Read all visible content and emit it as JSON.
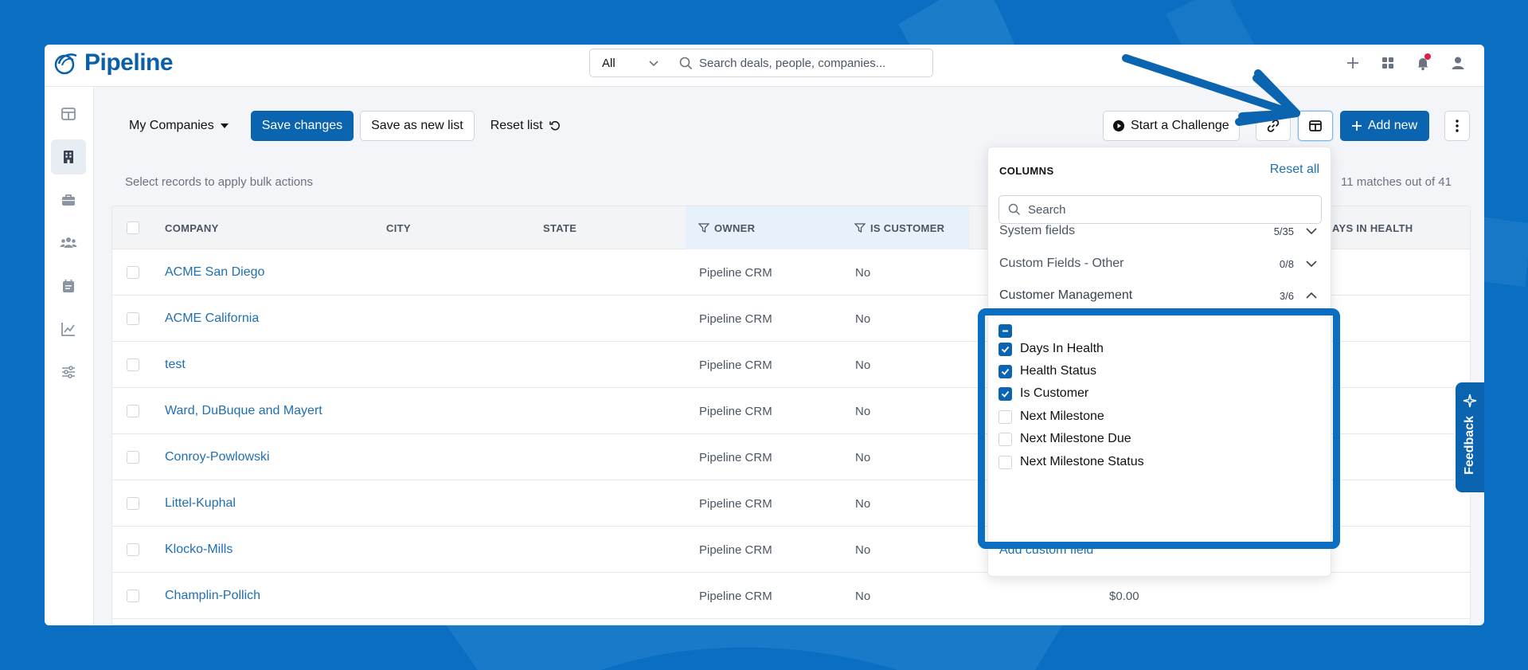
{
  "app": {
    "logo_text": "Pipeline",
    "brand_color": "#0b5fa8",
    "accent_color": "#0b64b0",
    "background_color": "#0a6fc2"
  },
  "topbar": {
    "scope_value": "All",
    "search_placeholder": "Search deals, people, companies...",
    "icons": [
      "plus-icon",
      "apps-grid-icon",
      "bell-icon",
      "user-icon"
    ]
  },
  "sidebar": {
    "items": [
      {
        "name": "dashboard",
        "icon": "layout-icon",
        "active": false
      },
      {
        "name": "companies",
        "icon": "building-icon",
        "active": true
      },
      {
        "name": "deals",
        "icon": "briefcase-icon",
        "active": false
      },
      {
        "name": "people",
        "icon": "people-icon",
        "active": false
      },
      {
        "name": "calendar",
        "icon": "calendar-icon",
        "active": false
      },
      {
        "name": "reports",
        "icon": "chart-line-icon",
        "active": false
      },
      {
        "name": "settings",
        "icon": "sliders-icon",
        "active": false
      }
    ]
  },
  "toolbar": {
    "list_name": "My Companies",
    "save_changes": "Save changes",
    "save_as_new": "Save as new list",
    "reset_list": "Reset list",
    "start_challenge": "Start a Challenge",
    "add_new": "Add new"
  },
  "bulk_hint": "Select records to apply bulk actions",
  "matches": "11 matches out of 41",
  "table": {
    "columns": [
      {
        "label": "COMPANY",
        "filtered": false
      },
      {
        "label": "CITY",
        "filtered": false
      },
      {
        "label": "STATE",
        "filtered": false
      },
      {
        "label": "OWNER",
        "filtered": true
      },
      {
        "label": "IS CUSTOMER",
        "filtered": true
      },
      {
        "label": "AYS IN HEALTH",
        "filtered": false
      }
    ],
    "rows": [
      {
        "company": "ACME San Diego",
        "owner": "Pipeline CRM",
        "is_customer": "No",
        "extra": ""
      },
      {
        "company": "ACME California",
        "owner": "Pipeline CRM",
        "is_customer": "No",
        "extra": ""
      },
      {
        "company": "test",
        "owner": "Pipeline CRM",
        "is_customer": "No",
        "extra": ""
      },
      {
        "company": "Ward, DuBuque and Mayert",
        "owner": "Pipeline CRM",
        "is_customer": "No",
        "extra": ""
      },
      {
        "company": "Conroy-Powlowski",
        "owner": "Pipeline CRM",
        "is_customer": "No",
        "extra": ""
      },
      {
        "company": "Littel-Kuphal",
        "owner": "Pipeline CRM",
        "is_customer": "No",
        "extra": ""
      },
      {
        "company": "Klocko-Mills",
        "owner": "Pipeline CRM",
        "is_customer": "No",
        "extra": ""
      },
      {
        "company": "Champlin-Pollich",
        "owner": "Pipeline CRM",
        "is_customer": "No",
        "extra": "$0.00"
      }
    ]
  },
  "columns_panel": {
    "title": "COLUMNS",
    "reset_all": "Reset all",
    "search_placeholder": "Search",
    "groups": [
      {
        "label": "System fields",
        "count": "5/35",
        "expanded": false
      },
      {
        "label": "Custom Fields - Other",
        "count": "0/8",
        "expanded": false
      }
    ],
    "customer_management": {
      "label": "Customer Management",
      "count": "3/6",
      "options": [
        {
          "label": "Days In Health",
          "checked": true
        },
        {
          "label": "Health Status",
          "checked": true
        },
        {
          "label": "Is Customer",
          "checked": true
        },
        {
          "label": "Next Milestone",
          "checked": false
        },
        {
          "label": "Next Milestone Due",
          "checked": false
        },
        {
          "label": "Next Milestone Status",
          "checked": false
        }
      ]
    },
    "add_custom_field": "Add custom field"
  },
  "feedback": {
    "label": "Feedback"
  }
}
